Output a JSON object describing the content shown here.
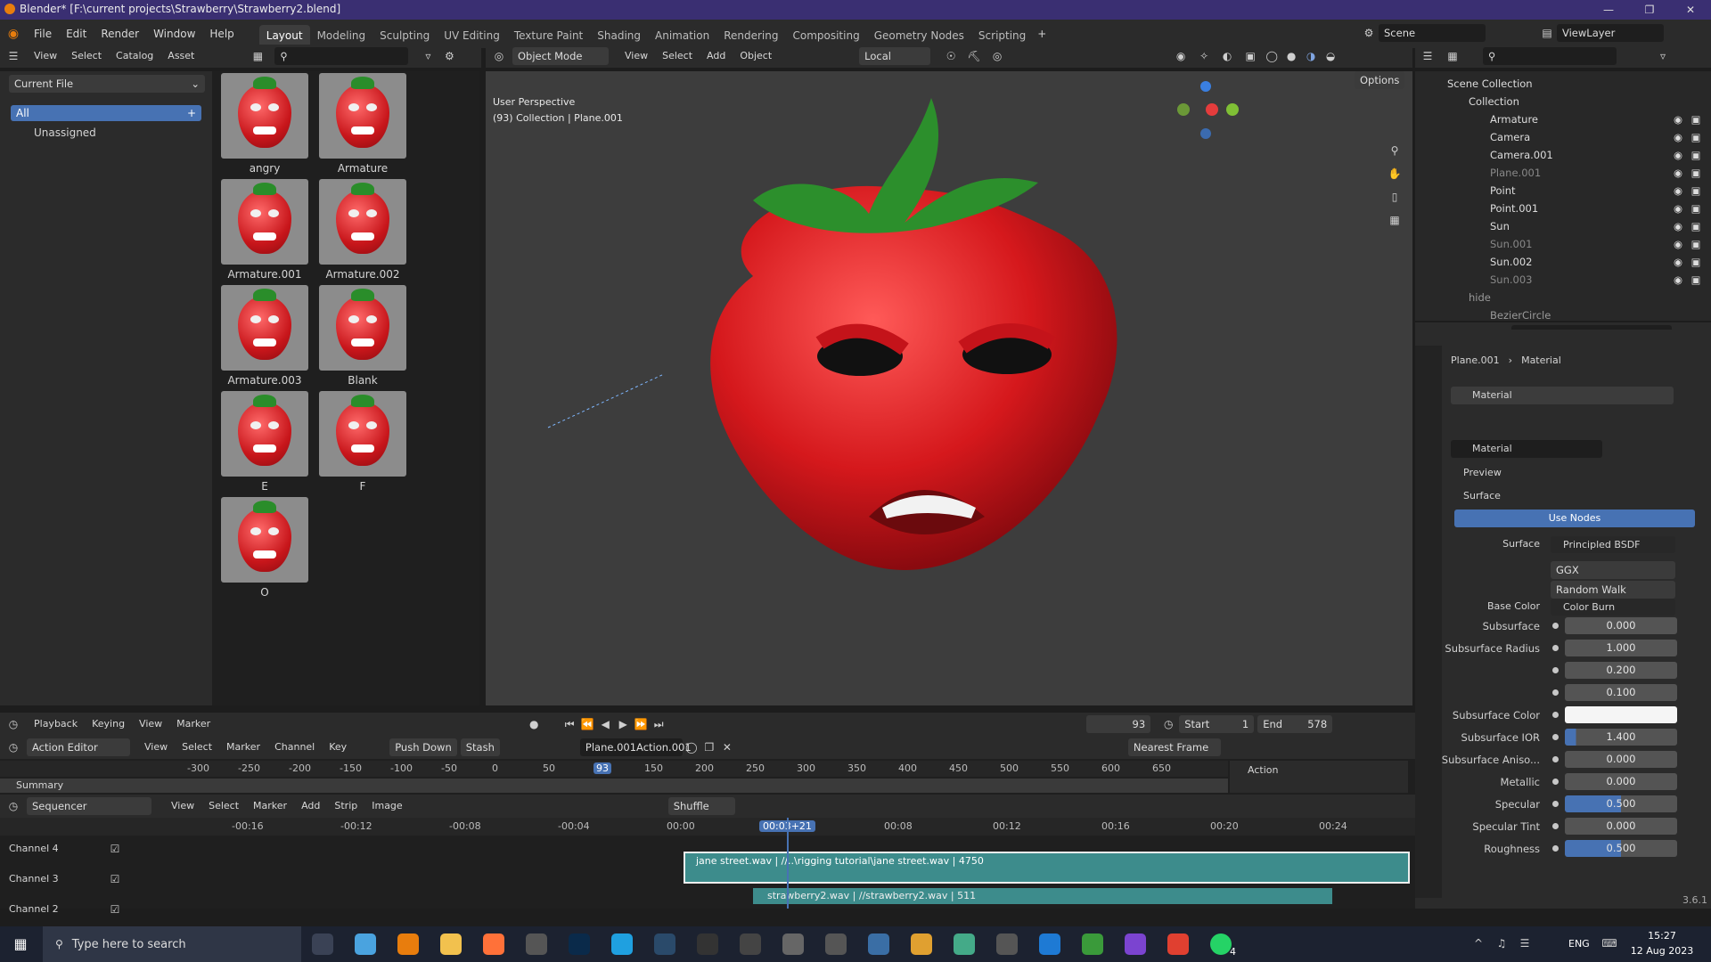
{
  "window": {
    "title": "Blender* [F:\\current projects\\Strawberry\\Strawberry2.blend]"
  },
  "menu": [
    "File",
    "Edit",
    "Render",
    "Window",
    "Help"
  ],
  "workspaces": [
    "Layout",
    "Modeling",
    "Sculpting",
    "UV Editing",
    "Texture Paint",
    "Shading",
    "Animation",
    "Rendering",
    "Compositing",
    "Geometry Nodes",
    "Scripting"
  ],
  "active_workspace": "Layout",
  "scene": "Scene",
  "view_layer": "ViewLayer",
  "asset_browser": {
    "menus": [
      "View",
      "Select",
      "Catalog",
      "Asset"
    ],
    "library": "Current File",
    "catalogs": [
      "All",
      "Unassigned"
    ],
    "assets": [
      "angry",
      "Armature",
      "Armature.001",
      "Armature.002",
      "Armature.003",
      "Blank",
      "E",
      "F",
      "O"
    ]
  },
  "viewport": {
    "mode": "Object Mode",
    "menus": [
      "View",
      "Select",
      "Add",
      "Object"
    ],
    "transform": "Local",
    "options": "Options",
    "overlay_title": "User Perspective",
    "overlay_sub": "(93) Collection | Plane.001"
  },
  "outliner": {
    "root": "Scene Collection",
    "collection": "Collection",
    "items": [
      "Armature",
      "Camera",
      "Camera.001",
      "Plane.001",
      "Point",
      "Point.001",
      "Sun",
      "Sun.001",
      "Sun.002",
      "Sun.003"
    ],
    "hide": "hide",
    "hide_item": "BezierCircle"
  },
  "properties": {
    "breadcrumb_obj": "Plane.001",
    "breadcrumb_mat": "Material",
    "slot": "Material",
    "material_name": "Material",
    "preview": "Preview",
    "surface_panel": "Surface",
    "use_nodes": "Use Nodes",
    "surface_label": "Surface",
    "surface_value": "Principled BSDF",
    "distribution": "GGX",
    "sss_method": "Random Walk",
    "base_color_label": "Base Color",
    "base_color_value": "Color Burn",
    "rows": [
      {
        "label": "Subsurface",
        "value": "0.000"
      },
      {
        "label": "Subsurface Radius",
        "value": "1.000"
      },
      {
        "label": "",
        "value": "0.200"
      },
      {
        "label": "",
        "value": "0.100"
      },
      {
        "label": "Subsurface Color",
        "value": ""
      },
      {
        "label": "Subsurface IOR",
        "value": "1.400"
      },
      {
        "label": "Subsurface Aniso...",
        "value": "0.000"
      },
      {
        "label": "Metallic",
        "value": "0.000"
      },
      {
        "label": "Specular",
        "value": "0.500"
      },
      {
        "label": "Specular Tint",
        "value": "0.000"
      },
      {
        "label": "Roughness",
        "value": "0.500"
      }
    ],
    "version": "3.6.1"
  },
  "playback": {
    "menus": [
      "Playback",
      "Keying",
      "View",
      "Marker"
    ],
    "current_frame": "93",
    "start_label": "Start",
    "start": "1",
    "end_label": "End",
    "end": "578"
  },
  "action_editor": {
    "mode": "Action Editor",
    "menus": [
      "View",
      "Select",
      "Marker",
      "Channel",
      "Key"
    ],
    "push_down": "Push Down",
    "stash": "Stash",
    "action": "Plane.001Action.001",
    "snap": "Nearest Frame",
    "panel": "Action",
    "summary": "Summary",
    "ticks": [
      "-300",
      "-250",
      "-200",
      "-150",
      "-100",
      "-50",
      "0",
      "50",
      "93",
      "150",
      "200",
      "250",
      "300",
      "350",
      "400",
      "450",
      "500",
      "550",
      "600",
      "650"
    ]
  },
  "sequencer": {
    "mode": "Sequencer",
    "menus": [
      "View",
      "Select",
      "Marker",
      "Add",
      "Strip",
      "Image"
    ],
    "shuffle": "Shuffle",
    "ticks": [
      "-00:16",
      "-00:12",
      "-00:08",
      "-00:04",
      "00:00",
      "00:03+21",
      "00:08",
      "00:12",
      "00:16",
      "00:20",
      "00:24"
    ],
    "channels": [
      "Channel 4",
      "Channel 3",
      "Channel 2"
    ],
    "strip1": "jane street.wav | //..\\rigging tutorial\\jane street.wav | 4750",
    "strip2": "strawberry2.wav | //strawberry2.wav | 511"
  },
  "taskbar": {
    "search": "Type here to search",
    "lang": "ENG",
    "time": "15:27",
    "date": "12 Aug 2023",
    "badge": "4"
  }
}
